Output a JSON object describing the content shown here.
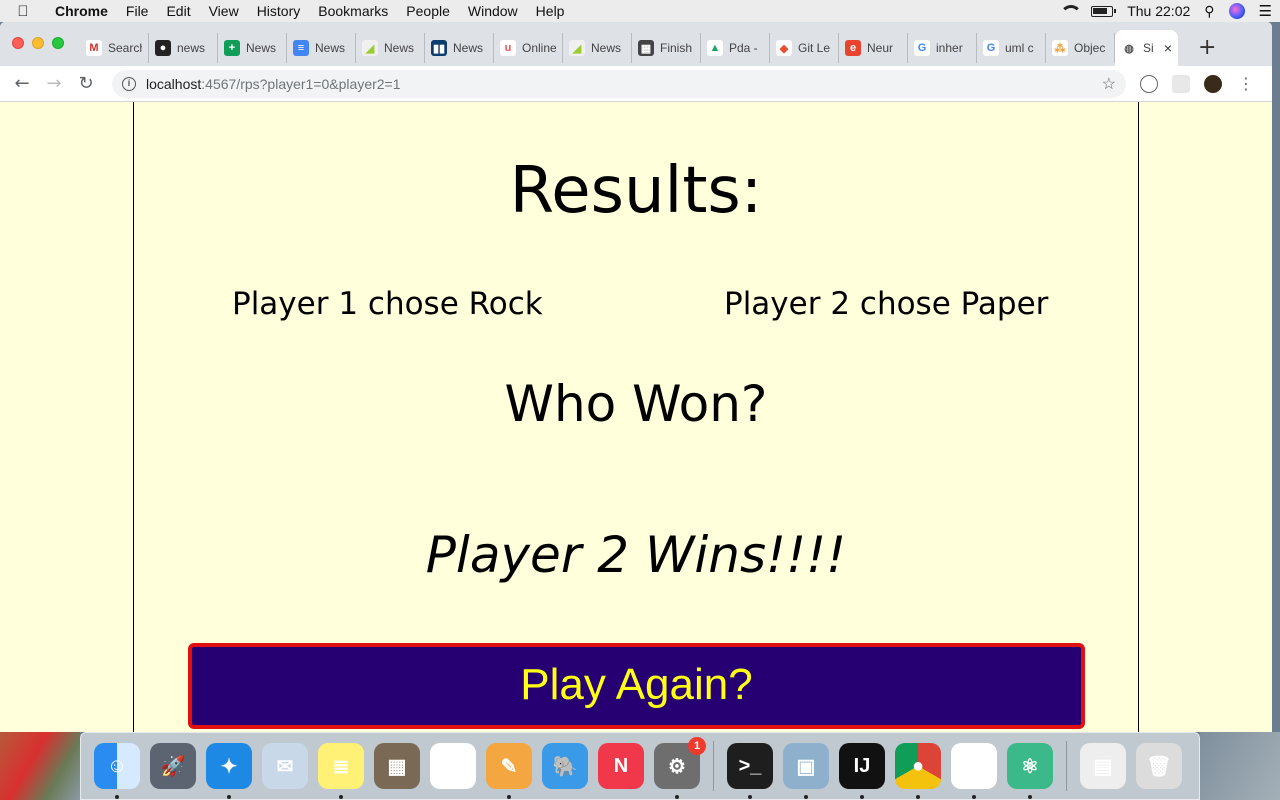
{
  "menubar": {
    "apple": "",
    "items": [
      "Chrome",
      "File",
      "Edit",
      "View",
      "History",
      "Bookmarks",
      "People",
      "Window",
      "Help"
    ],
    "clock": "Thu 22:02"
  },
  "tabs": [
    {
      "title": "Search",
      "icon": "gmail-icon",
      "fav": "M",
      "color": "#ffffff",
      "fg": "#d93025"
    },
    {
      "title": "news",
      "icon": "github-icon",
      "fav": "●",
      "color": "#222222",
      "fg": "#ffffff"
    },
    {
      "title": "News",
      "icon": "sheets-icon",
      "fav": "+",
      "color": "#0f9d58",
      "fg": "#ffffff"
    },
    {
      "title": "News",
      "icon": "docs-icon",
      "fav": "≡",
      "color": "#4285f4",
      "fg": "#ffffff"
    },
    {
      "title": "News",
      "icon": "nz-icon",
      "fav": "◢",
      "color": "#f0f0f0",
      "fg": "#9acd32"
    },
    {
      "title": "News",
      "icon": "trello-icon",
      "fav": "▮▮",
      "color": "#0b3d6e",
      "fg": "#ffffff"
    },
    {
      "title": "Online",
      "icon": "udemy-icon",
      "fav": "u",
      "color": "#ffffff",
      "fg": "#ec5252"
    },
    {
      "title": "News",
      "icon": "nz-icon",
      "fav": "◢",
      "color": "#f0f0f0",
      "fg": "#9acd32"
    },
    {
      "title": "Finish",
      "icon": "notion-icon",
      "fav": "▦",
      "color": "#444444",
      "fg": "#ffffff"
    },
    {
      "title": "Pda -",
      "icon": "drive-icon",
      "fav": "▲",
      "color": "#ffffff",
      "fg": "#1fa463"
    },
    {
      "title": "Git Le",
      "icon": "git-icon",
      "fav": "◆",
      "color": "#ffffff",
      "fg": "#e84e31"
    },
    {
      "title": "Neur",
      "icon": "e-icon",
      "fav": "e",
      "color": "#e8432e",
      "fg": "#ffffff"
    },
    {
      "title": "inher",
      "icon": "google-icon",
      "fav": "G",
      "color": "#ffffff",
      "fg": "#4285f4"
    },
    {
      "title": "uml c",
      "icon": "google-icon",
      "fav": "G",
      "color": "#ffffff",
      "fg": "#4285f4"
    },
    {
      "title": "Objec",
      "icon": "nodes-icon",
      "fav": "⁂",
      "color": "#ffffff",
      "fg": "#f29c38"
    },
    {
      "title": "Si",
      "icon": "globe-icon",
      "fav": "◍",
      "color": "#ffffff",
      "fg": "#555555",
      "active": true
    }
  ],
  "omnibox": {
    "host": "localhost",
    "path": ":4567/rps?player1=0&player2=1"
  },
  "page": {
    "title": "Results:",
    "player1": "Player 1 chose Rock",
    "player2": "Player 2 chose Paper",
    "question": "Who Won?",
    "winner": "Player 2 Wins!!!!",
    "button": "Play Again?"
  },
  "colors": {
    "background": "#ffffdc",
    "button_bg": "#260073",
    "button_border": "#e01010",
    "button_text": "#ffff14"
  },
  "dock": {
    "apps": [
      {
        "name": "finder-icon",
        "bg": "linear-gradient(90deg,#2a8cf0 50%,#d6eaff 50%)",
        "glyph": "☺",
        "running": true
      },
      {
        "name": "launchpad-icon",
        "bg": "#5b6470",
        "glyph": "🚀",
        "running": false
      },
      {
        "name": "safari-icon",
        "bg": "#1e88e5",
        "glyph": "✦",
        "running": true
      },
      {
        "name": "mail-icon",
        "bg": "#c8d8e8",
        "glyph": "✉",
        "running": false
      },
      {
        "name": "notes-icon",
        "bg": "#fff176",
        "glyph": "≣",
        "running": true
      },
      {
        "name": "calculator-icon",
        "bg": "#7a6a55",
        "glyph": "▦",
        "running": false
      },
      {
        "name": "photos-icon",
        "bg": "#ffffff",
        "glyph": "✿",
        "running": false
      },
      {
        "name": "pages-icon",
        "bg": "#f4a640",
        "glyph": "✎",
        "running": true
      },
      {
        "name": "tableplus-icon",
        "bg": "#3a9ae8",
        "glyph": "🐘",
        "running": false
      },
      {
        "name": "news-app-icon",
        "bg": "#f0384a",
        "glyph": "N",
        "running": false
      },
      {
        "name": "system-preferences-icon",
        "bg": "#6e6e6e",
        "glyph": "⚙",
        "running": true,
        "badge": "1"
      },
      {
        "sep": true
      },
      {
        "name": "terminal-icon",
        "bg": "#1e1e1e",
        "glyph": ">_",
        "running": true
      },
      {
        "name": "preview-icon",
        "bg": "#8fb0cc",
        "glyph": "▣",
        "running": true
      },
      {
        "name": "intellij-icon",
        "bg": "#111111",
        "glyph": "IJ",
        "running": true
      },
      {
        "name": "chrome-icon",
        "bg": "conic-gradient(#db4437 0 120deg,#f4c20d 0 240deg,#0f9d58 0)",
        "glyph": "●",
        "running": true
      },
      {
        "name": "slack-icon",
        "bg": "#ffffff",
        "glyph": "#",
        "running": true
      },
      {
        "name": "atom-icon",
        "bg": "#3cb98a",
        "glyph": "⚛",
        "running": true
      },
      {
        "sep": true
      },
      {
        "name": "downloads-stack-icon",
        "bg": "#eeeeee",
        "glyph": "▤",
        "running": false
      },
      {
        "name": "trash-icon",
        "bg": "#dcdcdc",
        "glyph": "🗑",
        "running": false
      }
    ]
  }
}
